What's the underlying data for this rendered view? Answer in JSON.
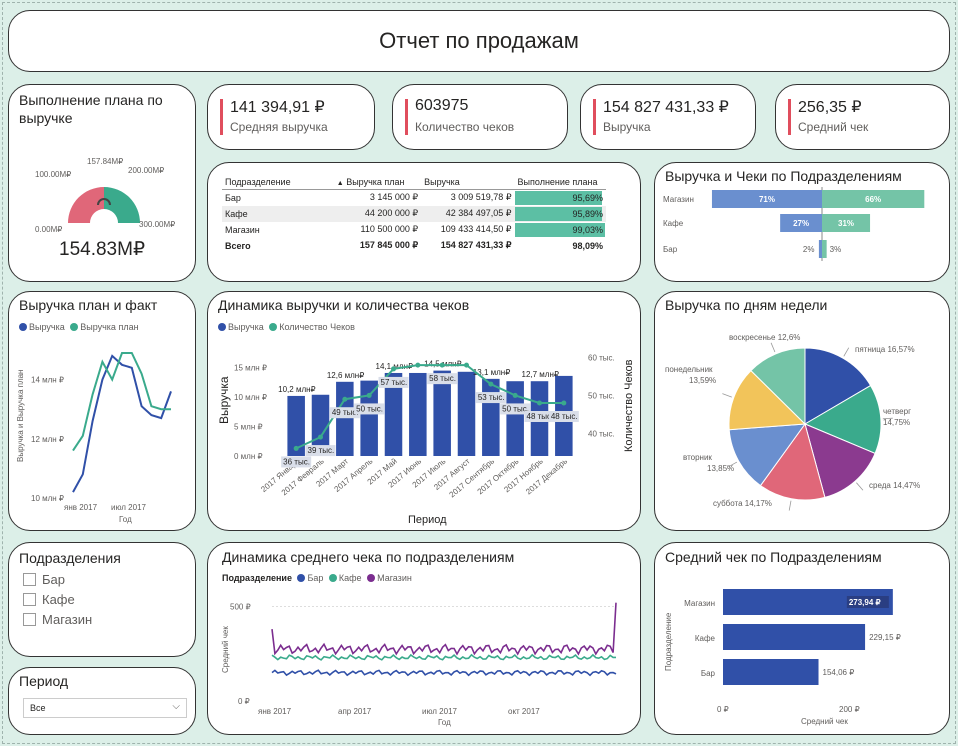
{
  "title": "Отчет по продажам",
  "colors": {
    "dark_blue": "#3050a8",
    "teal": "#3aaa8c",
    "purple": "#7b2d8f",
    "accent_red": "#e04e5d",
    "green_fill": "#5cbfa4",
    "blue_bar": "#6a8fcf"
  },
  "gauge": {
    "title": "Выполнение плана по выручке",
    "value_label": "154.83M₽",
    "min_label": "0.00M₽",
    "max_label": "300.00M₽",
    "left_label": "100.00M₽",
    "right_label": "200.00M₽",
    "target_label": "157.84M₽",
    "value": 154.83,
    "target": 157.84,
    "max": 300
  },
  "kpis": [
    {
      "value": "141 394,91 ₽",
      "label": "Средняя выручка"
    },
    {
      "value": "603975",
      "label": "Количество чеков"
    },
    {
      "value": "154 827 431,33 ₽",
      "label": "Выручка"
    },
    {
      "value": "256,35 ₽",
      "label": "Средний чек"
    }
  ],
  "plan_table": {
    "headers": [
      "Подразделение",
      "Выручка план",
      "Выручка",
      "Выполнение плана"
    ],
    "rows": [
      {
        "name": "Бар",
        "plan": "3 145 000 ₽",
        "fact": "3 009 519,78 ₽",
        "pct": "95,69%",
        "pct_value": 95.69
      },
      {
        "name": "Кафе",
        "plan": "44 200 000 ₽",
        "fact": "42 384 497,05 ₽",
        "pct": "95,89%",
        "pct_value": 95.89
      },
      {
        "name": "Магазин",
        "plan": "110 500 000 ₽",
        "fact": "109 433 414,50 ₽",
        "pct": "99,03%",
        "pct_value": 99.03
      }
    ],
    "total": {
      "name": "Всего",
      "plan": "157 845 000 ₽",
      "fact": "154 827 431,33 ₽",
      "pct": "98,09%"
    }
  },
  "butterfly": {
    "title": "Выручка и Чеки по Подразделениям",
    "rows": [
      {
        "name": "Магазин",
        "left": 71,
        "right": 66,
        "left_label": "71%",
        "right_label": "66%"
      },
      {
        "name": "Кафе",
        "left": 27,
        "right": 31,
        "left_label": "27%",
        "right_label": "31%"
      },
      {
        "name": "Бар",
        "left": 2,
        "right": 3,
        "left_label": "2%",
        "right_label": "3%"
      }
    ]
  },
  "slicer_units": {
    "title": "Подразделения",
    "items": [
      "Бар",
      "Кафе",
      "Магазин"
    ]
  },
  "slicer_period": {
    "title": "Период",
    "value": "Все"
  },
  "chart_data": [
    {
      "type": "line",
      "title": "Выручка план и факт",
      "ylabel": "Выручка и Выручка план",
      "xlabel": "Год",
      "x_ticks": [
        "янв 2017",
        "июл 2017"
      ],
      "y_ticks": [
        "10 млн ₽",
        "12 млн ₽",
        "14 млн ₽"
      ],
      "ylim": [
        10,
        15
      ],
      "series": [
        {
          "name": "Выручка",
          "values": [
            10.2,
            10.8,
            12.6,
            14.0,
            14.8,
            14.5,
            14.4,
            13.1,
            12.8,
            12.7,
            13.6
          ]
        },
        {
          "name": "Выручка план",
          "values": [
            11.6,
            12.1,
            13.5,
            14.6,
            14.0,
            14.9,
            14.9,
            14.2,
            13.1,
            13.0,
            13.0
          ]
        }
      ]
    },
    {
      "type": "bar",
      "title": "Динамика выручки и количества чеков",
      "xlabel": "Период",
      "ylabel": "Выручка",
      "y2label": "Количество Чеков",
      "categories": [
        "2017 Январь",
        "2017 Февраль",
        "2017 Март",
        "2017 Апрель",
        "2017 Май",
        "2017 Июнь",
        "2017 Июль",
        "2017 Август",
        "2017 Сентябрь",
        "2017 Октябрь",
        "2017 Ноябрь",
        "2017 Декабрь"
      ],
      "y_ticks": [
        "0 млн ₽",
        "5 млн ₽",
        "10 млн ₽",
        "15 млн ₽"
      ],
      "y2_ticks": [
        "40 тыс.",
        "50 тыс.",
        "60 тыс."
      ],
      "series": [
        {
          "name": "Выручка",
          "values": [
            10.2,
            10.4,
            12.6,
            12.8,
            14.1,
            14.1,
            14.5,
            14.3,
            13.1,
            12.7,
            12.7,
            13.6
          ],
          "labels": [
            "10,2 млн₽",
            "",
            "12,6 млн₽",
            "",
            "14,1 млн₽",
            "",
            "14,5 млн₽",
            "",
            "13,1 млн₽",
            "",
            "12,7 млн₽",
            ""
          ]
        },
        {
          "name": "Количество Чеков",
          "values": [
            36,
            39,
            49,
            50,
            57,
            58,
            58,
            58,
            53,
            50,
            48,
            48
          ],
          "labels": [
            "36 тыс.",
            "39 тыс.",
            "49 тыс.",
            "50 тыс.",
            "57 тыс.",
            "",
            "58 тыс.",
            "",
            "53 тыс.",
            "50 тыс.",
            "48 тыс.",
            "48 тыс."
          ]
        }
      ]
    },
    {
      "type": "pie",
      "title": "Выручка по дням недели",
      "slices": [
        {
          "name": "пятница",
          "value": 16.57,
          "label": "пятница 16,57%",
          "color": "#3050a8"
        },
        {
          "name": "четверг",
          "value": 14.75,
          "label": "четверг 14,75%",
          "color": "#3aaa8c"
        },
        {
          "name": "среда",
          "value": 14.47,
          "label": "среда 14,47%",
          "color": "#8b3a8f"
        },
        {
          "name": "суббота",
          "value": 14.17,
          "label": "суббота 14,17%",
          "color": "#e06779"
        },
        {
          "name": "вторник",
          "value": 13.85,
          "label": "вторник 13,85%",
          "color": "#6a8fcf"
        },
        {
          "name": "понедельник",
          "value": 13.59,
          "label": "понедельник 13,59%",
          "color": "#f2c45a"
        },
        {
          "name": "воскресенье",
          "value": 12.6,
          "label": "воскресенье 12,6%",
          "color": "#74c4a7"
        }
      ]
    },
    {
      "type": "line",
      "title": "Динамика среднего чека по подразделениям",
      "legend_title": "Подразделение",
      "xlabel": "Год",
      "ylabel": "Средний чек",
      "x_ticks": [
        "янв 2017",
        "апр 2017",
        "июл 2017",
        "окт 2017"
      ],
      "y_ticks": [
        "0 ₽",
        "500 ₽"
      ],
      "ylim": [
        0,
        550
      ],
      "series": [
        {
          "name": "Бар",
          "approx_level": 150
        },
        {
          "name": "Кафе",
          "approx_level": 230
        },
        {
          "name": "Магазин",
          "approx_level": 275
        }
      ]
    },
    {
      "type": "bar",
      "orientation": "horizontal",
      "title": "Средний чек по Подразделениям",
      "xlabel": "Средний чек",
      "ylabel": "Подразделение",
      "categories": [
        "Магазин",
        "Кафе",
        "Бар"
      ],
      "values": [
        273.94,
        229.15,
        154.06
      ],
      "labels": [
        "273,94 ₽",
        "229,15 ₽",
        "154,06 ₽"
      ],
      "x_ticks": [
        "0 ₽",
        "200 ₽"
      ]
    }
  ]
}
